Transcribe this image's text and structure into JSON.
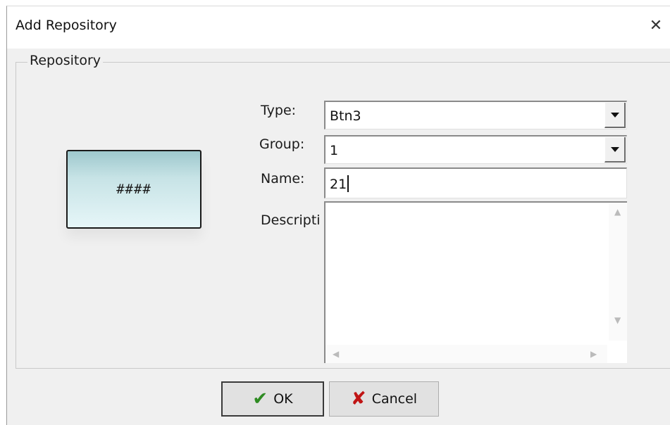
{
  "dialog": {
    "title": "Add Repository",
    "close_glyph": "✕"
  },
  "repository": {
    "legend": "Repository",
    "preview_text": "####",
    "type_label": "Type:",
    "type_value": "Btn3",
    "group_label": "Group:",
    "group_value": "1",
    "name_label": "Name:",
    "name_value": "21",
    "description_label": "Descripti",
    "description_value": ""
  },
  "buttons": {
    "ok_label": "OK",
    "cancel_label": "Cancel",
    "ok_icon": "check-icon",
    "cancel_icon": "x-icon"
  },
  "colors": {
    "ok_icon": "#2e8b22",
    "cancel_icon": "#c01515",
    "preview_gradient_top": "#9ec8cd",
    "preview_gradient_bottom": "#e6f6f8"
  }
}
